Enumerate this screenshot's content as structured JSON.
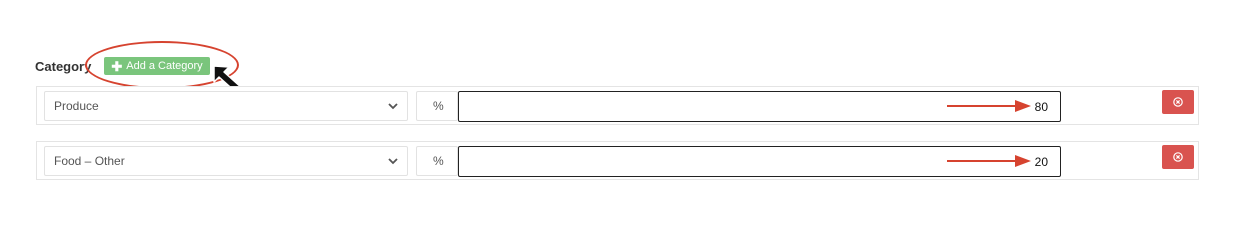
{
  "category_section": {
    "label": "Category",
    "add_button_label": "Add a Category",
    "add_button_icon": "plus-icon",
    "accent_color": "#7ac57c"
  },
  "rows": [
    {
      "category": "Produce",
      "percent_symbol": "%",
      "value": "80",
      "remove_icon": "close-circle-icon"
    },
    {
      "category": "Food – Other",
      "percent_symbol": "%",
      "value": "20",
      "remove_icon": "close-circle-icon"
    }
  ],
  "colors": {
    "remove_button": "#d9534f",
    "annotation": "#d6432f"
  }
}
